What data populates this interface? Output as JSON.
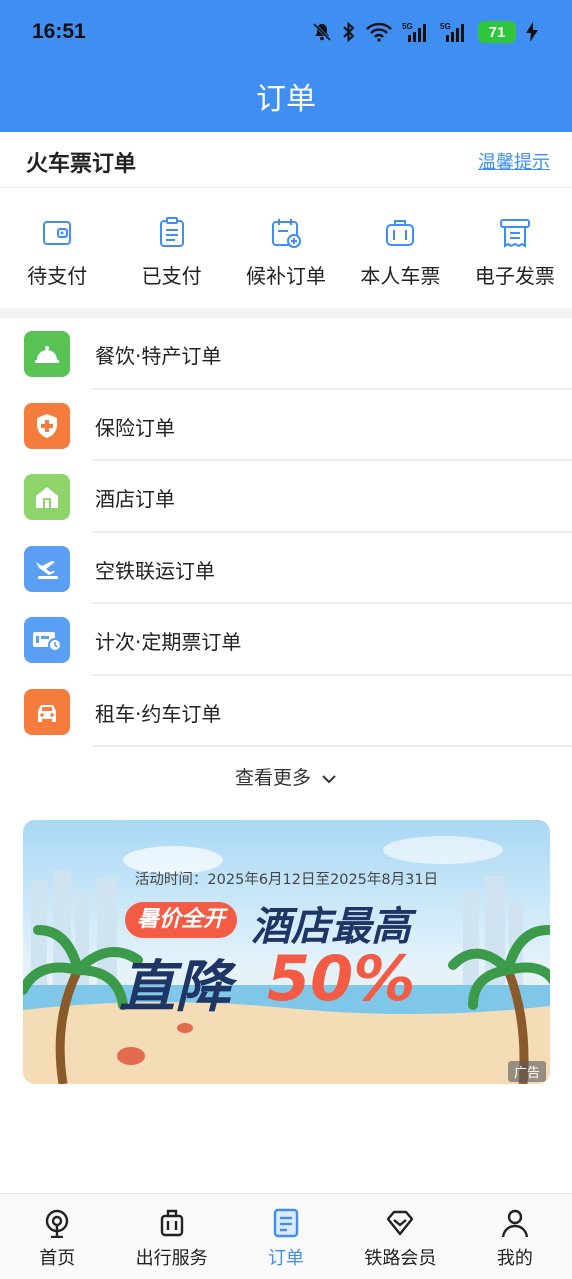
{
  "status_bar": {
    "time": "16:51",
    "battery": "71"
  },
  "header": {
    "title": "订单"
  },
  "train_section": {
    "title": "火车票订单",
    "tip_link": "温馨提示",
    "quick_actions": [
      {
        "label": "待支付",
        "icon": "wallet-icon"
      },
      {
        "label": "已支付",
        "icon": "clipboard-icon"
      },
      {
        "label": "候补订单",
        "icon": "calendar-add-icon"
      },
      {
        "label": "本人车票",
        "icon": "suitcase-icon"
      },
      {
        "label": "电子发票",
        "icon": "receipt-icon"
      }
    ]
  },
  "orders": [
    {
      "label": "餐饮·特产订单",
      "icon": "dining-bell-icon",
      "color": "#58c255"
    },
    {
      "label": "保险订单",
      "icon": "shield-plus-icon",
      "color": "#f47c3c"
    },
    {
      "label": "酒店订单",
      "icon": "house-icon",
      "color": "#8fd36b"
    },
    {
      "label": "空铁联运订单",
      "icon": "plane-train-icon",
      "color": "#5b9ff5"
    },
    {
      "label": "计次·定期票订单",
      "icon": "ticket-clock-icon",
      "color": "#5b9ff5"
    },
    {
      "label": "租车·约车订单",
      "icon": "car-icon",
      "color": "#f47c3c"
    }
  ],
  "more_label": "查看更多",
  "ad": {
    "period": "活动时间：2025年6月12日至2025年8月31日",
    "pill": "暑价全开",
    "line1": "酒店最高",
    "line2_prefix": "直降",
    "line2_value": "50%",
    "tag": "广告"
  },
  "tabbar": [
    {
      "label": "首页",
      "icon": "home-train-icon",
      "active": false
    },
    {
      "label": "出行服务",
      "icon": "luggage-icon",
      "active": false
    },
    {
      "label": "订单",
      "icon": "order-doc-icon",
      "active": true
    },
    {
      "label": "铁路会员",
      "icon": "diamond-icon",
      "active": false
    },
    {
      "label": "我的",
      "icon": "person-icon",
      "active": false
    }
  ],
  "colors": {
    "brand": "#3f8ff2",
    "accent_red": "#f35b45"
  }
}
